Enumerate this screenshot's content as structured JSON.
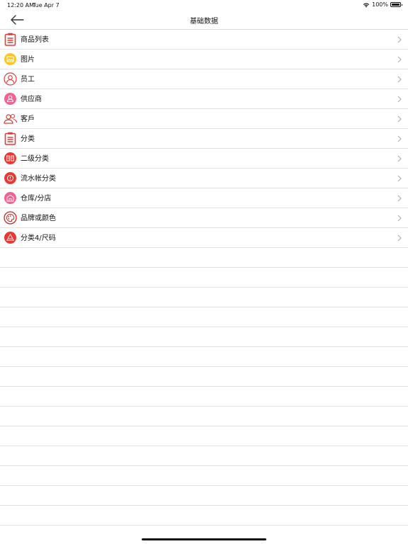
{
  "status_bar": {
    "time": "12:20 AM",
    "date": "Tue Apr 7",
    "battery": "100%",
    "battery_level": 1.0
  },
  "nav": {
    "title": "基础数据",
    "back_icon": "arrow-left-icon"
  },
  "colors": {
    "red": "#e53935",
    "yellow": "#f7c825",
    "pink": "#f06292",
    "separator": "#e3e3e3",
    "chevron": "#b0b0b0"
  },
  "items": [
    {
      "label": "商品列表",
      "icon": "clipboard-list-icon"
    },
    {
      "label": "图片",
      "icon": "image-icon"
    },
    {
      "label": "员工",
      "icon": "employee-icon"
    },
    {
      "label": "供应商",
      "icon": "supplier-icon"
    },
    {
      "label": "客戶",
      "icon": "customers-icon"
    },
    {
      "label": "分类",
      "icon": "clipboard-list-icon"
    },
    {
      "label": "二级分类",
      "icon": "subcategory-icon"
    },
    {
      "label": "流水帐分类",
      "icon": "journal-category-icon"
    },
    {
      "label": "仓库/分店",
      "icon": "warehouse-icon"
    },
    {
      "label": "品牌或颜色",
      "icon": "palette-icon"
    },
    {
      "label": "分类4/尺码",
      "icon": "size-icon"
    }
  ]
}
